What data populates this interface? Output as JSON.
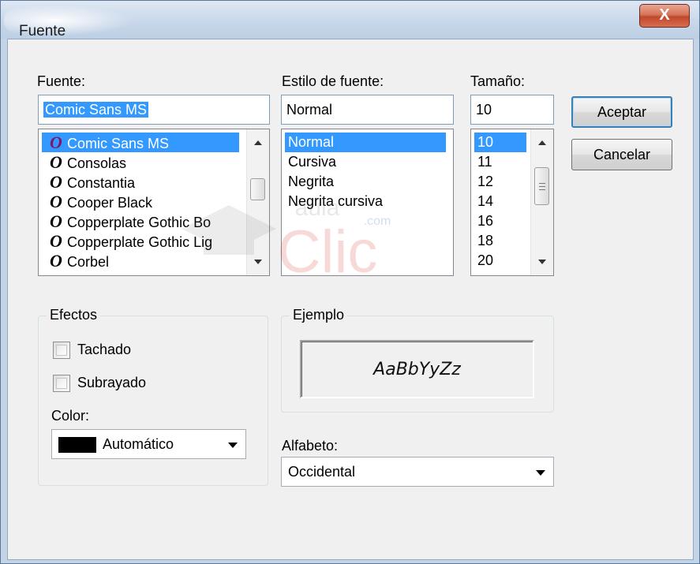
{
  "window": {
    "title": "Fuente",
    "close_label": "X"
  },
  "font": {
    "label": "Fuente:",
    "value": "Comic Sans MS",
    "items": [
      "Comic Sans MS",
      "Consolas",
      "Constantia",
      "Cooper Black",
      "Copperplate Gothic Bo",
      "Copperplate Gothic Lig",
      "Corbel"
    ],
    "selected": "Comic Sans MS",
    "item_icon_glyph": "O",
    "item_icon": "opentype-font-icon"
  },
  "style": {
    "label": "Estilo de fuente:",
    "value": "Normal",
    "items": [
      "Normal",
      "Cursiva",
      "Negrita",
      "Negrita cursiva"
    ],
    "selected": "Normal"
  },
  "size": {
    "label": "Tamaño:",
    "value": "10",
    "items": [
      "10",
      "11",
      "12",
      "14",
      "16",
      "18",
      "20"
    ],
    "selected": "10"
  },
  "buttons": {
    "ok": "Aceptar",
    "cancel": "Cancelar"
  },
  "effects": {
    "legend": "Efectos",
    "strikethrough": {
      "label": "Tachado",
      "checked": false
    },
    "underline": {
      "label": "Subrayado",
      "checked": false
    },
    "color_label": "Color:",
    "color_value": "Automático",
    "color_swatch": "#000000"
  },
  "sample": {
    "legend": "Ejemplo",
    "text": "AaBbYyZz"
  },
  "script": {
    "label": "Alfabeto:",
    "value": "Occidental"
  },
  "watermark": {
    "brand": "Clic",
    "prefix": "aula",
    "suffix": ".com"
  },
  "colors": {
    "selection": "#3399ff",
    "title_bar": "#c3d4e6",
    "close_button": "#c2482c"
  }
}
